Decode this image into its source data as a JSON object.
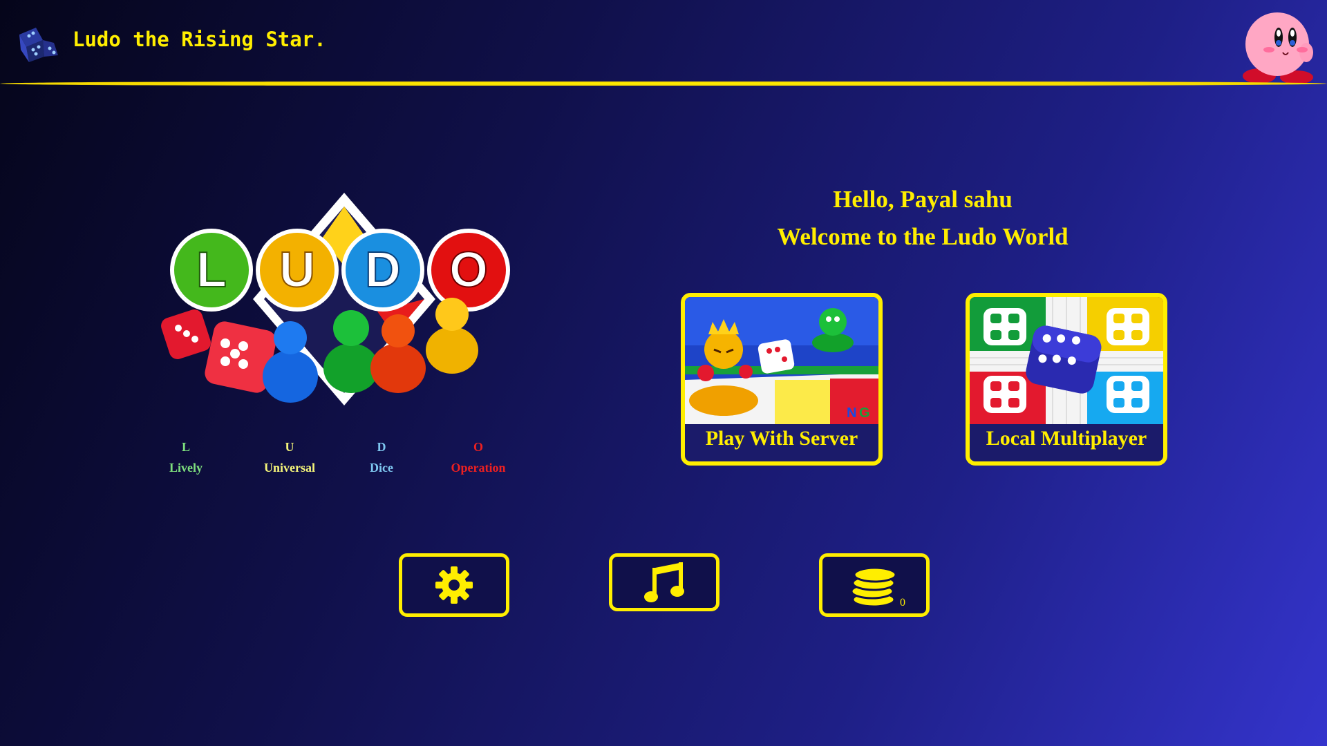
{
  "header": {
    "title": "Ludo the Rising Star.",
    "app_icon": "dice-icon",
    "avatar_icon": "kirby-avatar-icon"
  },
  "logo": {
    "letters": [
      "L",
      "U",
      "D",
      "O"
    ],
    "legend": [
      {
        "letter": "L",
        "word": "Lively",
        "color": "#7ee07e"
      },
      {
        "letter": "U",
        "word": "Universal",
        "color": "#f5f57a"
      },
      {
        "letter": "D",
        "word": "Dice",
        "color": "#7ec7f0"
      },
      {
        "letter": "O",
        "word": "Operation",
        "color": "#ee2020"
      }
    ]
  },
  "greeting": {
    "hello": "Hello, Payal sahu",
    "welcome": "Welcome to the Ludo World"
  },
  "modes": [
    {
      "label": "Play With Server",
      "icon": "server-game-art"
    },
    {
      "label": "Local Multiplayer",
      "icon": "ludo-board-art"
    }
  ],
  "toolbar": {
    "settings_icon": "gear-icon",
    "music_icon": "music-note-icon",
    "coins_icon": "coins-icon",
    "coin_count": "0"
  },
  "colors": {
    "accent": "#ffee00",
    "background_start": "#05051a",
    "background_end": "#3434cc"
  }
}
